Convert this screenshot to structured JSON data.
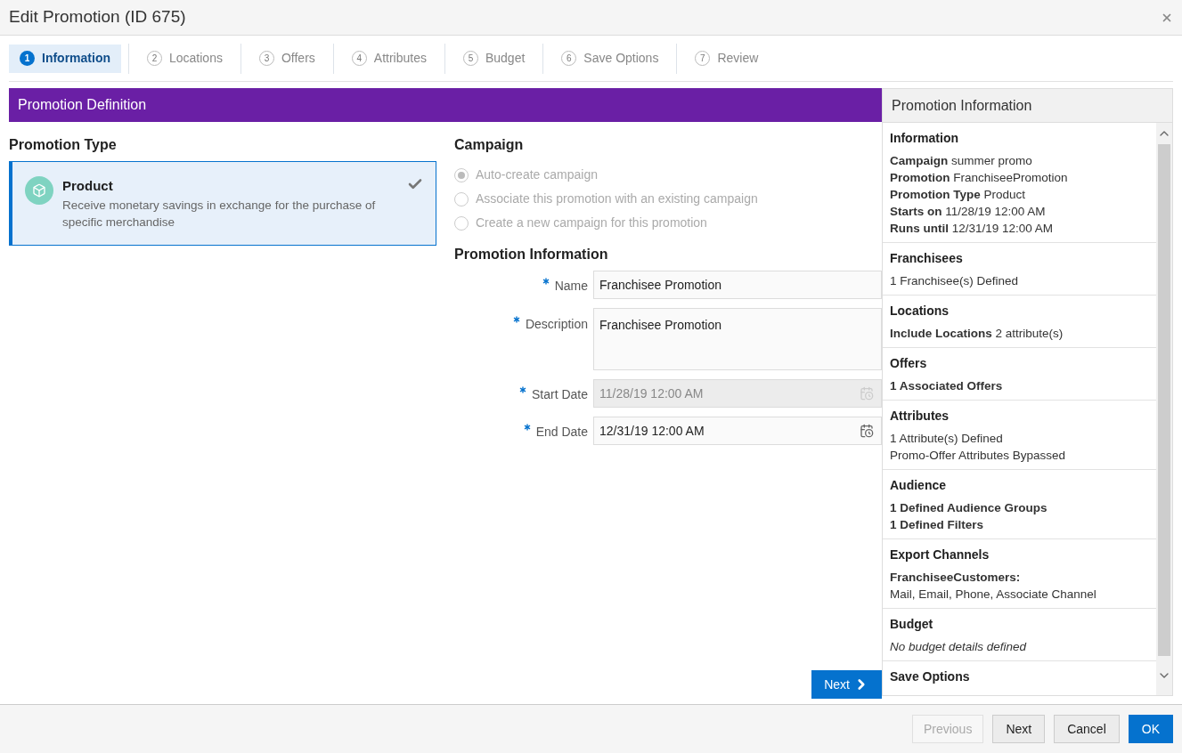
{
  "window": {
    "title": "Edit Promotion (ID 675)"
  },
  "steps": [
    {
      "number": "1",
      "label": "Information",
      "selected": true
    },
    {
      "number": "2",
      "label": "Locations",
      "selected": false
    },
    {
      "number": "3",
      "label": "Offers",
      "selected": false
    },
    {
      "number": "4",
      "label": "Attributes",
      "selected": false
    },
    {
      "number": "5",
      "label": "Budget",
      "selected": false
    },
    {
      "number": "6",
      "label": "Save Options",
      "selected": false
    },
    {
      "number": "7",
      "label": "Review",
      "selected": false
    }
  ],
  "definition": {
    "title": "Promotion Definition",
    "promotion_type": {
      "heading": "Promotion Type",
      "options": [
        {
          "title": "Product",
          "description": "Receive monetary savings in exchange for the purchase of specific merchandise",
          "selected": true
        }
      ]
    },
    "campaign": {
      "heading": "Campaign",
      "options": [
        {
          "label": "Auto-create campaign",
          "selected": true,
          "disabled": true
        },
        {
          "label": "Associate this promotion with an existing campaign",
          "selected": false,
          "disabled": true
        },
        {
          "label": "Create a new campaign for this promotion",
          "selected": false,
          "disabled": true
        }
      ]
    },
    "promotion_information": {
      "heading": "Promotion Information",
      "fields": [
        {
          "kind": "text",
          "label": "Name",
          "required": true,
          "value": "Franchisee Promotion",
          "disabled": false
        },
        {
          "kind": "textarea",
          "label": "Description",
          "required": true,
          "value": "Franchisee Promotion",
          "disabled": false
        },
        {
          "kind": "date",
          "label": "Start Date",
          "required": true,
          "value": "11/28/19 12:00 AM",
          "disabled": true
        },
        {
          "kind": "date",
          "label": "End Date",
          "required": true,
          "value": "12/31/19 12:00 AM",
          "disabled": false
        }
      ]
    },
    "next_button": "Next"
  },
  "info_panel": {
    "title": "Promotion Information",
    "sections": [
      {
        "heading": "Information",
        "italic": false,
        "lines": [
          "**Campaign** summer promo",
          "**Promotion** FranchiseePromotion",
          "**Promotion Type** Product",
          "**Starts on** 11/28/19 12:00 AM",
          "**Runs until** 12/31/19 12:00 AM"
        ]
      },
      {
        "heading": "Franchisees",
        "italic": false,
        "lines": [
          "1 Franchisee(s) Defined"
        ]
      },
      {
        "heading": "Locations",
        "italic": false,
        "lines": [
          "**Include Locations** 2 attribute(s)"
        ]
      },
      {
        "heading": "Offers",
        "italic": false,
        "lines": [
          "**1 Associated Offers**"
        ]
      },
      {
        "heading": "Attributes",
        "italic": false,
        "lines": [
          "1 Attribute(s) Defined",
          "Promo-Offer Attributes Bypassed"
        ]
      },
      {
        "heading": "Audience",
        "italic": false,
        "lines": [
          "**1 Defined Audience Groups**",
          "**1 Defined Filters**"
        ]
      },
      {
        "heading": "Export Channels",
        "italic": false,
        "lines": [
          "**FranchiseeCustomers:**",
          "Mail, Email, Phone, Associate Channel"
        ]
      },
      {
        "heading": "Budget",
        "italic": true,
        "lines": [
          "No budget details defined"
        ]
      },
      {
        "heading": "Save Options"
      }
    ]
  },
  "footer_buttons": [
    {
      "kind": "default",
      "label": "Previous",
      "disabled": true
    },
    {
      "kind": "default",
      "label": "Next",
      "disabled": false
    },
    {
      "kind": "default",
      "label": "Cancel",
      "disabled": false
    },
    {
      "kind": "primary",
      "label": "OK",
      "disabled": false
    }
  ]
}
